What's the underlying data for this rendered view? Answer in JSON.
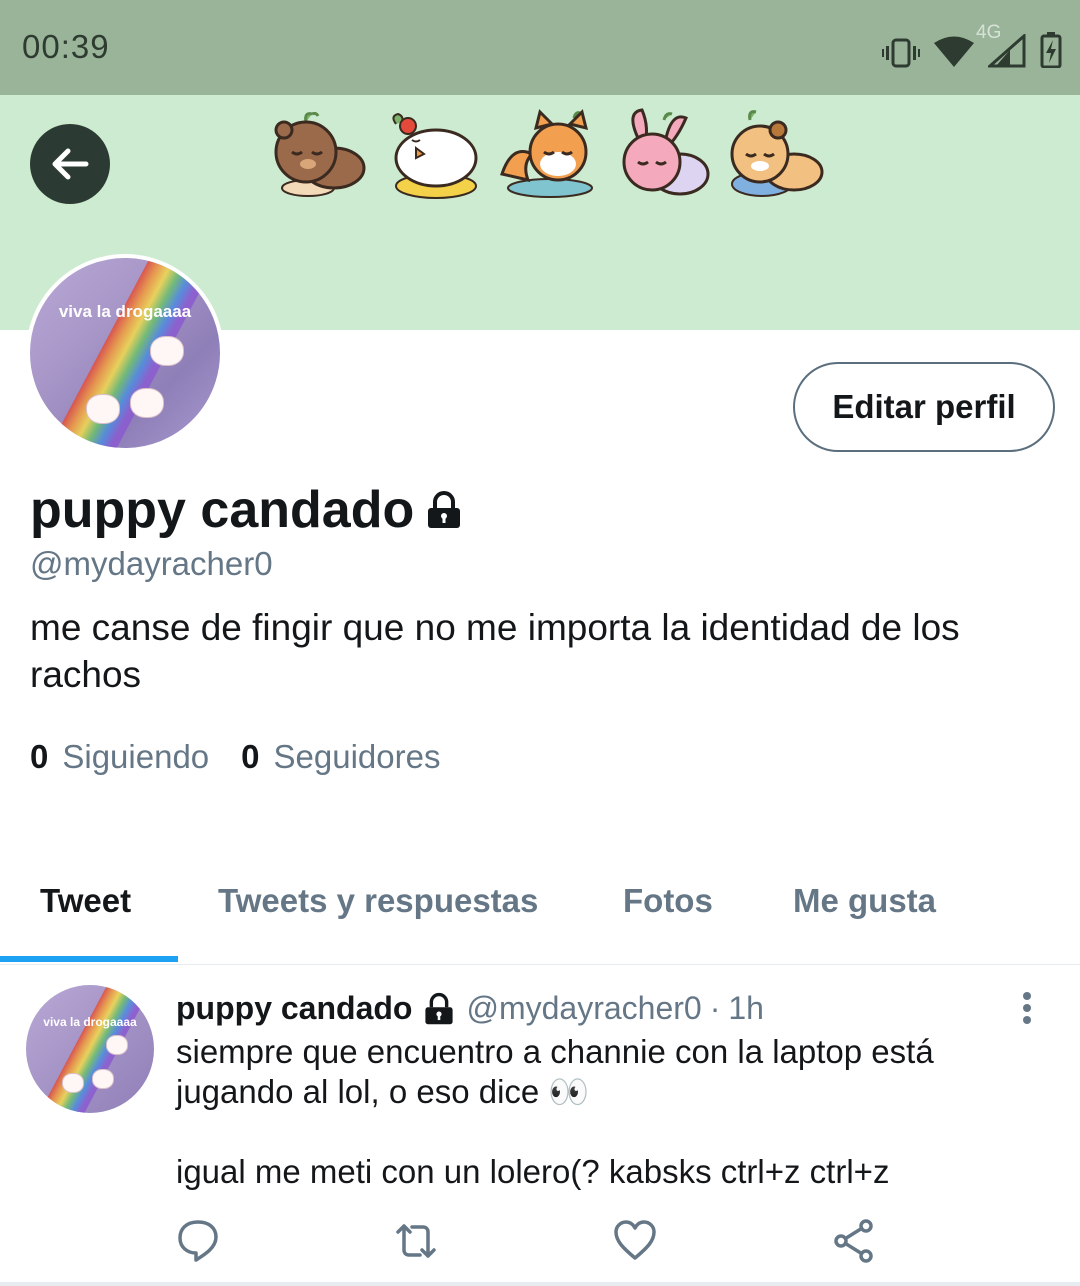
{
  "status_bar": {
    "time": "00:39",
    "network": "4G",
    "icons": [
      "vibrate-icon",
      "wifi-icon",
      "signal-icon",
      "battery-charging-icon"
    ]
  },
  "header": {
    "back_icon": "arrow-left-icon",
    "banner_color": "#cdebd0",
    "stickers": [
      "sleeping-bear-sticker",
      "sleeping-chick-sticker",
      "sleeping-fox-sticker",
      "sleeping-bunny-sticker",
      "sleeping-hamster-sticker"
    ]
  },
  "profile": {
    "avatar_text": "viva la drogaaaa",
    "edit_button": "Editar perfil",
    "display_name": "puppy candado",
    "protected_icon": "lock-icon",
    "handle": "@mydayracher0",
    "bio": "me canse de fingir que no me importa la identidad de los rachos",
    "following_count": "0",
    "following_label": "Siguiendo",
    "followers_count": "0",
    "followers_label": "Seguidores"
  },
  "tabs": [
    {
      "label": "Tweet",
      "active": true
    },
    {
      "label": "Tweets y respuestas",
      "active": false
    },
    {
      "label": "Fotos",
      "active": false
    },
    {
      "label": "Me gusta",
      "active": false
    }
  ],
  "tweet": {
    "avatar_text": "viva la drogaaaa",
    "name": "puppy candado",
    "handle": "@mydayracher0",
    "separator": "·",
    "time": "1h",
    "text": "siempre que encuentro a channie con la laptop está\njugando al lol, o eso dice 👀\n\nigual me meti con un lolero(? kabsks ctrl+z ctrl+z",
    "actions": [
      "reply-icon",
      "retweet-icon",
      "like-icon",
      "share-icon"
    ]
  },
  "colors": {
    "accent": "#1da1f2",
    "status_bar": "#9ab49a",
    "secondary_text": "#657786"
  }
}
